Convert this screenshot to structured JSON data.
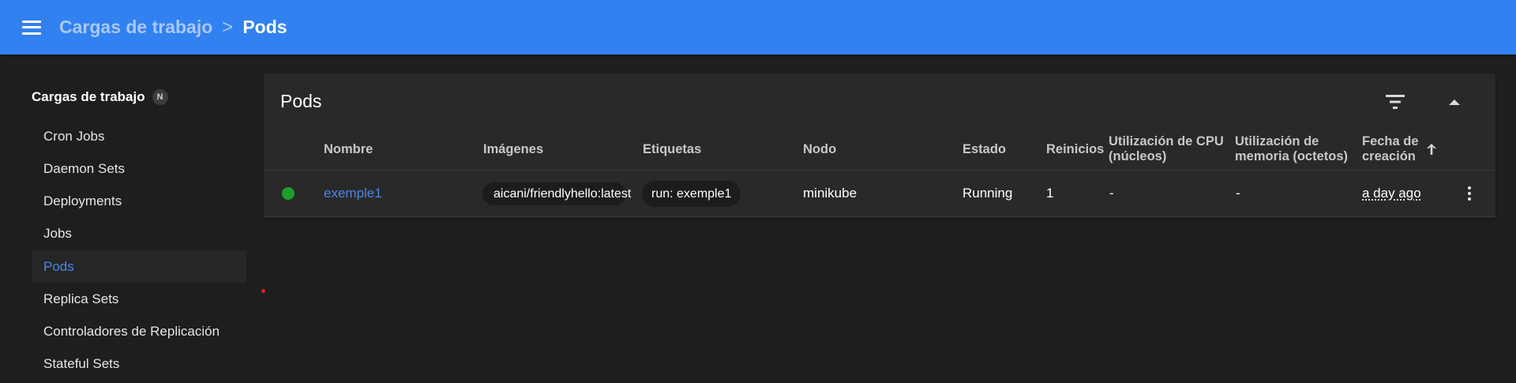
{
  "header": {
    "breadcrumb_parent": "Cargas de trabajo",
    "breadcrumb_separator": ">",
    "breadcrumb_current": "Pods",
    "accent_color": "#3281f0"
  },
  "sidebar": {
    "title": "Cargas de trabajo",
    "namespace_badge": "N",
    "items": [
      {
        "label": "Cron Jobs"
      },
      {
        "label": "Daemon Sets"
      },
      {
        "label": "Deployments"
      },
      {
        "label": "Jobs"
      },
      {
        "label": "Pods",
        "active": true
      },
      {
        "label": "Replica Sets"
      },
      {
        "label": "Controladores de Replicación"
      },
      {
        "label": "Stateful Sets"
      }
    ]
  },
  "card": {
    "title": "Pods",
    "icons": [
      "filter-icon",
      "collapse-icon"
    ]
  },
  "table": {
    "columns": {
      "name": "Nombre",
      "images": "Imágenes",
      "labels": "Etiquetas",
      "node": "Nodo",
      "status": "Estado",
      "restarts": "Reinicios",
      "cpu": "Utilización de CPU (núcleos)",
      "memory": "Utilización de memoria (octetos)",
      "created": "Fecha de creación"
    },
    "sort_icon": "arrow-up-icon",
    "rows": [
      {
        "status_color": "#1f9e2a",
        "name": "exemple1",
        "image": "aicani/friendlyhello:latest",
        "label": "run: exemple1",
        "node": "minikube",
        "status": "Running",
        "restarts": "1",
        "cpu": "-",
        "memory": "-",
        "created": "a day ago"
      }
    ]
  }
}
